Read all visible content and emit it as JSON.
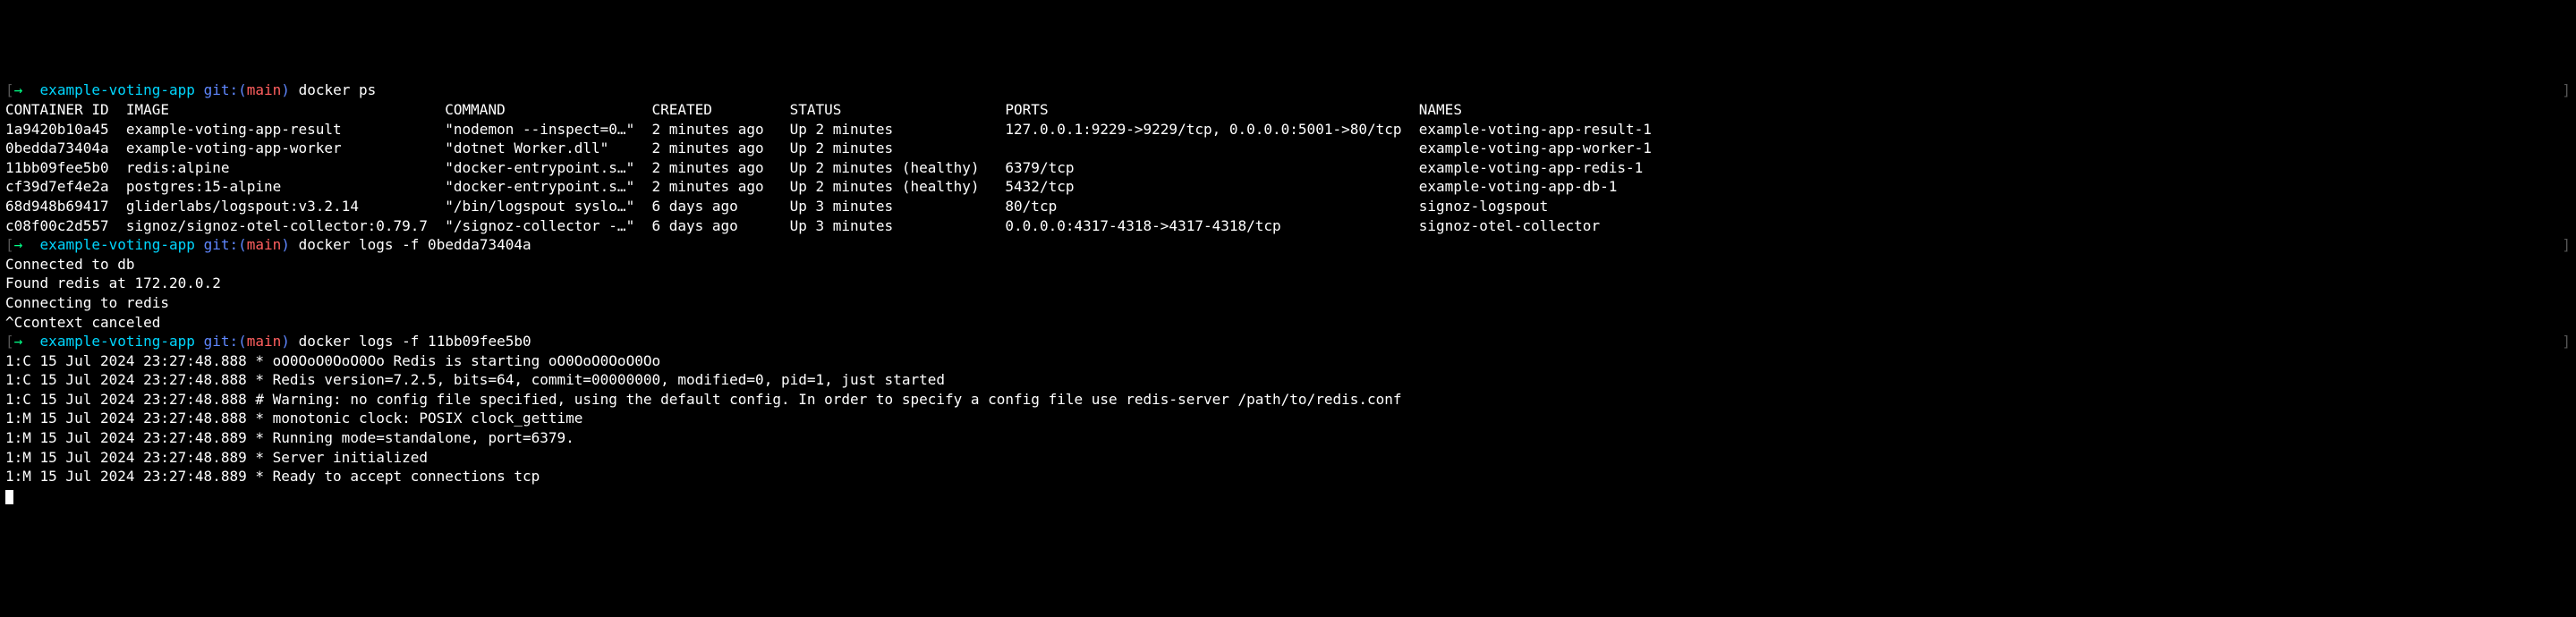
{
  "prompts": [
    {
      "arrow": "→",
      "dir": "example-voting-app",
      "git": "git:(",
      "branch": "main",
      "gitClose": ")",
      "cmd": "docker ps",
      "bracketLeft": "[",
      "bracketRight": "]"
    },
    {
      "arrow": "→",
      "dir": "example-voting-app",
      "git": "git:(",
      "branch": "main",
      "gitClose": ")",
      "cmd": "docker logs -f 0bedda73404a",
      "bracketLeft": "[",
      "bracketRight": "]"
    },
    {
      "arrow": "→",
      "dir": "example-voting-app",
      "git": "git:(",
      "branch": "main",
      "gitClose": ")",
      "cmd": "docker logs -f 11bb09fee5b0",
      "bracketLeft": "[",
      "bracketRight": "]"
    }
  ],
  "ps": {
    "headers": {
      "id": "CONTAINER ID",
      "image": "IMAGE",
      "command": "COMMAND",
      "created": "CREATED",
      "status": "STATUS",
      "ports": "PORTS",
      "names": "NAMES"
    },
    "rows": [
      {
        "id": "1a9420b10a45",
        "image": "example-voting-app-result",
        "command": "\"nodemon --inspect=0…\"",
        "created": "2 minutes ago",
        "status": "Up 2 minutes",
        "ports": "127.0.0.1:9229->9229/tcp, 0.0.0.0:5001->80/tcp",
        "names": "example-voting-app-result-1"
      },
      {
        "id": "0bedda73404a",
        "image": "example-voting-app-worker",
        "command": "\"dotnet Worker.dll\"",
        "created": "2 minutes ago",
        "status": "Up 2 minutes",
        "ports": "",
        "names": "example-voting-app-worker-1"
      },
      {
        "id": "11bb09fee5b0",
        "image": "redis:alpine",
        "command": "\"docker-entrypoint.s…\"",
        "created": "2 minutes ago",
        "status": "Up 2 minutes (healthy)",
        "ports": "6379/tcp",
        "names": "example-voting-app-redis-1"
      },
      {
        "id": "cf39d7ef4e2a",
        "image": "postgres:15-alpine",
        "command": "\"docker-entrypoint.s…\"",
        "created": "2 minutes ago",
        "status": "Up 2 minutes (healthy)",
        "ports": "5432/tcp",
        "names": "example-voting-app-db-1"
      },
      {
        "id": "68d948b69417",
        "image": "gliderlabs/logspout:v3.2.14",
        "command": "\"/bin/logspout syslo…\"",
        "created": "6 days ago",
        "status": "Up 3 minutes",
        "ports": "80/tcp",
        "names": "signoz-logspout"
      },
      {
        "id": "c08f00c2d557",
        "image": "signoz/signoz-otel-collector:0.79.7",
        "command": "\"/signoz-collector -…\"",
        "created": "6 days ago",
        "status": "Up 3 minutes",
        "ports": "0.0.0.0:4317-4318->4317-4318/tcp",
        "names": "signoz-otel-collector"
      }
    ]
  },
  "logs1": [
    "Connected to db",
    "Found redis at 172.20.0.2",
    "Connecting to redis",
    "^Ccontext canceled"
  ],
  "logs2": [
    "1:C 15 Jul 2024 23:27:48.888 * oO0OoO0OoO0Oo Redis is starting oO0OoO0OoO0Oo",
    "1:C 15 Jul 2024 23:27:48.888 * Redis version=7.2.5, bits=64, commit=00000000, modified=0, pid=1, just started",
    "1:C 15 Jul 2024 23:27:48.888 # Warning: no config file specified, using the default config. In order to specify a config file use redis-server /path/to/redis.conf",
    "1:M 15 Jul 2024 23:27:48.888 * monotonic clock: POSIX clock_gettime",
    "1:M 15 Jul 2024 23:27:48.889 * Running mode=standalone, port=6379.",
    "1:M 15 Jul 2024 23:27:48.889 * Server initialized",
    "1:M 15 Jul 2024 23:27:48.889 * Ready to accept connections tcp"
  ],
  "colwidth": {
    "id": 14,
    "image": 37,
    "command": 24,
    "created": 16,
    "status": 25,
    "ports": 48,
    "names": 0
  }
}
